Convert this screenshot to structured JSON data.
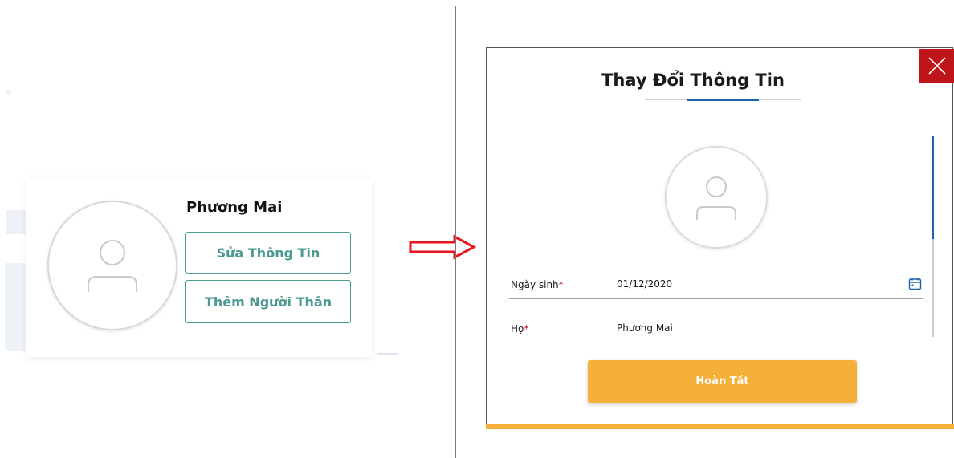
{
  "profile_card": {
    "name": "Phương Mai",
    "edit_button_label": "Sửa Thông Tin",
    "add_relative_button_label": "Thêm Người Thân"
  },
  "modal": {
    "title": "Thay Đổi Thông Tin",
    "fields": [
      {
        "label": "Ngày sinh",
        "required_mark": "*",
        "value": "01/12/2020"
      },
      {
        "label": "Họ",
        "required_mark": "*",
        "value": "Phương Mai"
      }
    ],
    "submit_label": "Hoàn Tất"
  },
  "icons": {
    "avatar": "user-icon",
    "close": "close-icon",
    "calendar": "calendar-icon",
    "arrow": "right-arrow-icon"
  },
  "colors": {
    "teal_accent": "#4a9a92",
    "primary_orange": "#f5b03a",
    "close_red": "#c0141b",
    "tab_blue": "#1d61b1",
    "arrow_red": "#e8141c",
    "required_red": "#d0021b"
  }
}
